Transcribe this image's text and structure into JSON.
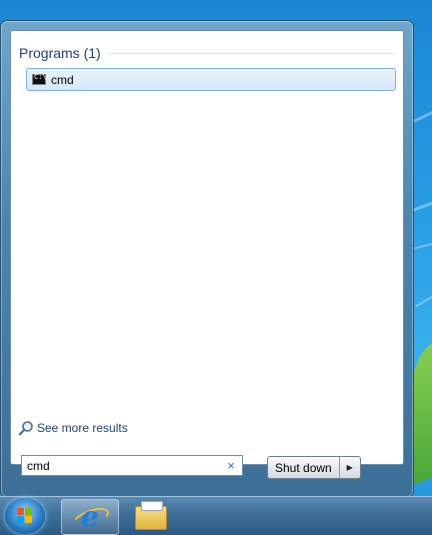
{
  "start_menu": {
    "section_title": "Programs (1)",
    "results": [
      {
        "label": "cmd",
        "icon": "command-prompt-icon"
      }
    ],
    "see_more_label": "See more results",
    "search": {
      "value": "cmd",
      "clear_glyph": "×"
    },
    "shutdown_label": "Shut down",
    "shutdown_arrow_glyph": "▶"
  },
  "taskbar": {
    "items": [
      {
        "name": "start-orb",
        "icon": "windows-logo-icon"
      },
      {
        "name": "internet-explorer",
        "icon": "internet-explorer-icon",
        "glyph": "e"
      },
      {
        "name": "windows-explorer",
        "icon": "folder-icon"
      }
    ]
  },
  "colors": {
    "accent_text": "#1e3f7a",
    "selection_border": "#7db2e3",
    "taskbar": "#3e6f98"
  }
}
